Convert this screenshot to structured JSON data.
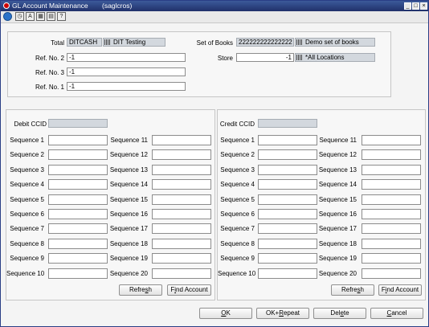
{
  "window": {
    "title": "GL Account Maintenance",
    "subtitle": "(saglcros)",
    "controls": [
      "minimize-icon",
      "maximize-icon",
      "close-icon"
    ]
  },
  "toolbar": {
    "icons": [
      {
        "name": "world-icon",
        "glyph": "●"
      },
      {
        "name": "clock-icon",
        "glyph": "◷"
      },
      {
        "name": "spellcheck-icon",
        "glyph": "A"
      },
      {
        "name": "calendar-icon",
        "glyph": "▦"
      },
      {
        "name": "note-icon",
        "glyph": "▤"
      },
      {
        "name": "help-icon",
        "glyph": "?"
      }
    ]
  },
  "header": {
    "total_label": "Total",
    "total_value": "DITCASH",
    "total_desc": "DIT Testing",
    "set_of_books_label": "Set of Books",
    "set_of_books_value": "222222222222222",
    "set_of_books_desc": "Demo set of books",
    "ref2_label": "Ref. No. 2",
    "ref2_value": "-1",
    "store_label": "Store",
    "store_value": "-1",
    "store_desc": "*All Locations",
    "ref3_label": "Ref. No. 3",
    "ref3_value": "-1",
    "ref1_label": "Ref. No. 1",
    "ref1_value": "-1"
  },
  "debit": {
    "ccid_label": "Debit CCID",
    "ccid_value": "",
    "seq_left": [
      {
        "label": "Sequence 1",
        "value": ""
      },
      {
        "label": "Sequence 2",
        "value": ""
      },
      {
        "label": "Sequence 3",
        "value": ""
      },
      {
        "label": "Sequence 4",
        "value": ""
      },
      {
        "label": "Sequence 5",
        "value": ""
      },
      {
        "label": "Sequence 6",
        "value": ""
      },
      {
        "label": "Sequence 7",
        "value": ""
      },
      {
        "label": "Sequence 8",
        "value": ""
      },
      {
        "label": "Sequence 9",
        "value": ""
      },
      {
        "label": "Sequence 10",
        "value": ""
      }
    ],
    "seq_right": [
      {
        "label": "Sequence 11",
        "value": ""
      },
      {
        "label": "Sequence 12",
        "value": ""
      },
      {
        "label": "Sequence 13",
        "value": ""
      },
      {
        "label": "Sequence 14",
        "value": ""
      },
      {
        "label": "Sequence 15",
        "value": ""
      },
      {
        "label": "Sequence 16",
        "value": ""
      },
      {
        "label": "Sequence 17",
        "value": ""
      },
      {
        "label": "Sequence 18",
        "value": ""
      },
      {
        "label": "Sequence 19",
        "value": ""
      },
      {
        "label": "Sequence 20",
        "value": ""
      }
    ],
    "refresh_pre": "Refre",
    "refresh_key": "s",
    "refresh_post": "h",
    "find_pre": "F",
    "find_key": "i",
    "find_post": "nd Account"
  },
  "credit": {
    "ccid_label": "Credit CCID",
    "ccid_value": "",
    "seq_left": [
      {
        "label": "Sequence 1",
        "value": ""
      },
      {
        "label": "Sequence 2",
        "value": ""
      },
      {
        "label": "Sequence 3",
        "value": ""
      },
      {
        "label": "Sequence 4",
        "value": ""
      },
      {
        "label": "Sequence 5",
        "value": ""
      },
      {
        "label": "Sequence  6",
        "value": ""
      },
      {
        "label": "Sequence 7",
        "value": ""
      },
      {
        "label": "Sequence 8",
        "value": ""
      },
      {
        "label": "Sequence 9",
        "value": ""
      },
      {
        "label": "Sequence 10",
        "value": ""
      }
    ],
    "seq_right": [
      {
        "label": "Sequence 11",
        "value": ""
      },
      {
        "label": "Sequence 12",
        "value": ""
      },
      {
        "label": "Sequence 13",
        "value": ""
      },
      {
        "label": "Sequence 14",
        "value": ""
      },
      {
        "label": "Sequence 15",
        "value": ""
      },
      {
        "label": "Sequence  16",
        "value": ""
      },
      {
        "label": "Sequence 17",
        "value": ""
      },
      {
        "label": "Sequence 18",
        "value": ""
      },
      {
        "label": "Sequence 19",
        "value": ""
      },
      {
        "label": "Sequence 20",
        "value": ""
      }
    ],
    "refresh_pre": "Refre",
    "refresh_key": "s",
    "refresh_post": "h",
    "find_pre": "F",
    "find_key": "i",
    "find_post": "nd Account"
  },
  "footer": {
    "ok_pre": "",
    "ok_key": "O",
    "ok_post": "K",
    "okrepeat_pre": "OK+",
    "okrepeat_key": "R",
    "okrepeat_post": "epeat",
    "delete_pre": "Del",
    "delete_key": "e",
    "delete_post": "te",
    "cancel_pre": "",
    "cancel_key": "C",
    "cancel_post": "ancel"
  }
}
